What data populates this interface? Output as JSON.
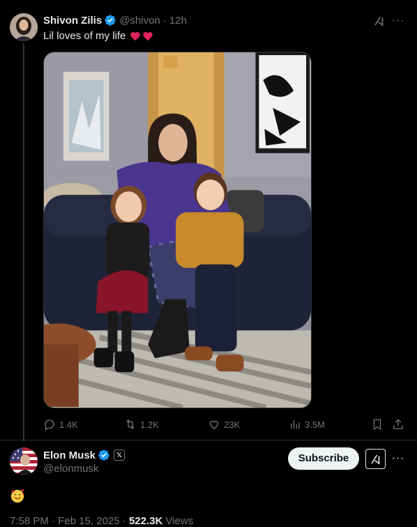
{
  "tweet1": {
    "author_name": "Shivon Zilis",
    "handle": "@shivon",
    "separator": "·",
    "time": "12h",
    "text": "Lil loves of my life",
    "hearts": "❤️❤️",
    "more": "···",
    "stats": {
      "replies": "1.4K",
      "reposts": "1.2K",
      "likes": "23K",
      "views": "3.5M"
    }
  },
  "tweet2": {
    "author_name": "Elon Musk",
    "handle": "@elonmusk",
    "x_badge": "𝕏",
    "subscribe_label": "Subscribe",
    "more": "···",
    "emoji": "🥰",
    "timestamp": "7:58 PM · Feb 15, 2025",
    "separator": " · ",
    "views_count": "522.3K",
    "views_label": " Views"
  },
  "colors": {
    "background": "#000000",
    "text_primary": "#e7e9ea",
    "text_secondary": "#71767b",
    "verified_blue": "#1d9bf0",
    "heart_red": "#e0245e",
    "divider": "#2f3336"
  },
  "icons": [
    "verified-badge-icon",
    "grok-icon",
    "more-icon",
    "reply-icon",
    "repost-icon",
    "like-icon",
    "views-icon",
    "bookmark-icon",
    "share-icon",
    "heart-icon",
    "smiling-face-with-hearts-emoji"
  ]
}
